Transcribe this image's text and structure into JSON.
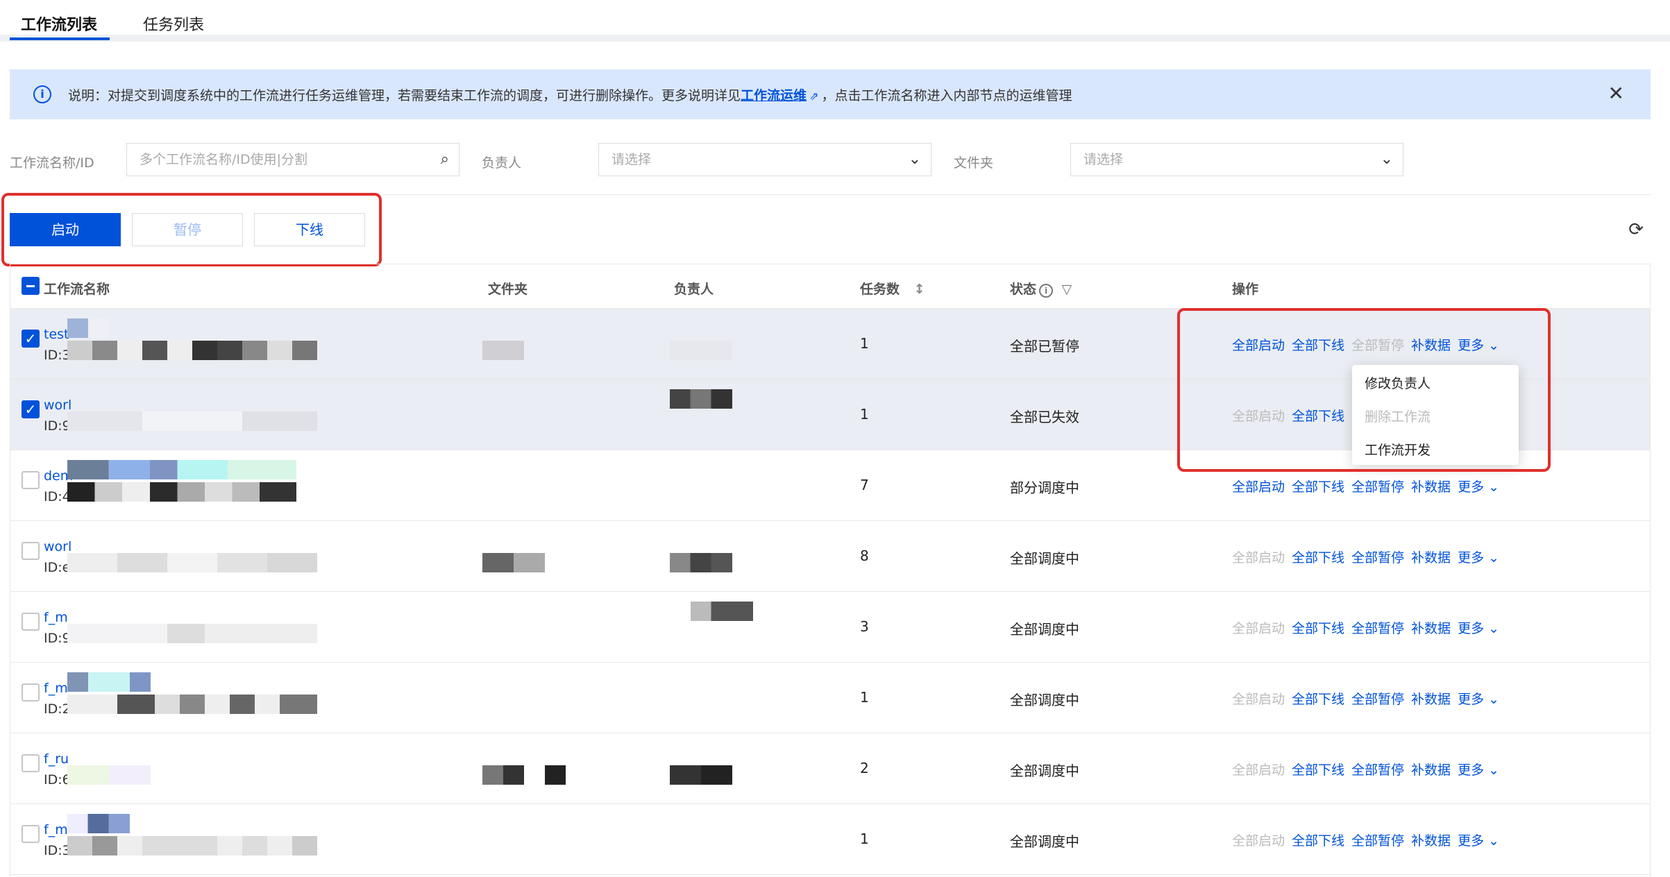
{
  "tabs": [
    {
      "label": "工作流列表"
    },
    {
      "label": "任务列表"
    }
  ],
  "notice": {
    "text_before": "说明：对提交到调度系统中的工作流进行任务运维管理，若需要结束工作流的调度，可进行删除操作。更多说明详见",
    "link": "工作流运维",
    "text_after": "，点击工作流名称进入内部节点的运维管理"
  },
  "filters": {
    "name_label": "工作流名称/ID",
    "name_placeholder": "多个工作流名称/ID使用|分割",
    "owner_label": "负责人",
    "owner_placeholder": "请选择",
    "folder_label": "文件夹",
    "folder_placeholder": "请选择"
  },
  "actions": {
    "start": "启动",
    "pause": "暂停",
    "offline": "下线"
  },
  "table": {
    "headers": {
      "name": "工作流名称",
      "folder": "文件夹",
      "owner": "负责人",
      "tasks": "任务数",
      "status": "状态",
      "ops": "操作"
    },
    "op_labels": {
      "start_all": "全部启动",
      "offline_all": "全部下线",
      "pause_all": "全部暂停",
      "backfill": "补数据",
      "more": "更多"
    },
    "rows": [
      {
        "name": "test",
        "id": "ID:3",
        "tasks": "1",
        "status": "全部已暂停",
        "checked": true
      },
      {
        "name": "worl",
        "id": "ID:9",
        "tasks": "1",
        "status": "全部已失效",
        "checked": true
      },
      {
        "name": "dem",
        "id": "ID:4",
        "tasks": "7",
        "status": "部分调度中",
        "checked": false
      },
      {
        "name": "worl",
        "id": "ID:e",
        "tasks": "8",
        "status": "全部调度中",
        "checked": false
      },
      {
        "name": "f_m",
        "id": "ID:9",
        "tasks": "3",
        "status": "全部调度中",
        "checked": false
      },
      {
        "name": "f_m",
        "id": "ID:2",
        "tasks": "1",
        "status": "全部调度中",
        "checked": false
      },
      {
        "name": "f_ru",
        "id": "ID:6",
        "tasks": "2",
        "status": "全部调度中",
        "checked": false
      },
      {
        "name": "f_m",
        "id": "ID:3",
        "tasks": "1",
        "status": "全部调度中",
        "checked": false
      }
    ]
  },
  "dropdown": {
    "items": [
      "修改负责人",
      "删除工作流",
      "工作流开发"
    ]
  },
  "icons": {
    "info": "info-icon",
    "external": "external-link-icon",
    "close": "close-icon",
    "search": "search-icon",
    "chevron": "chevron-down-icon",
    "refresh": "refresh-icon",
    "sort": "sort-icon",
    "filter": "filter-icon"
  },
  "colors": {
    "brand": "#0052d9",
    "highlight": "#e0302d",
    "notice_bg": "#d9e7fd",
    "selected_row": "#eaedf3"
  }
}
